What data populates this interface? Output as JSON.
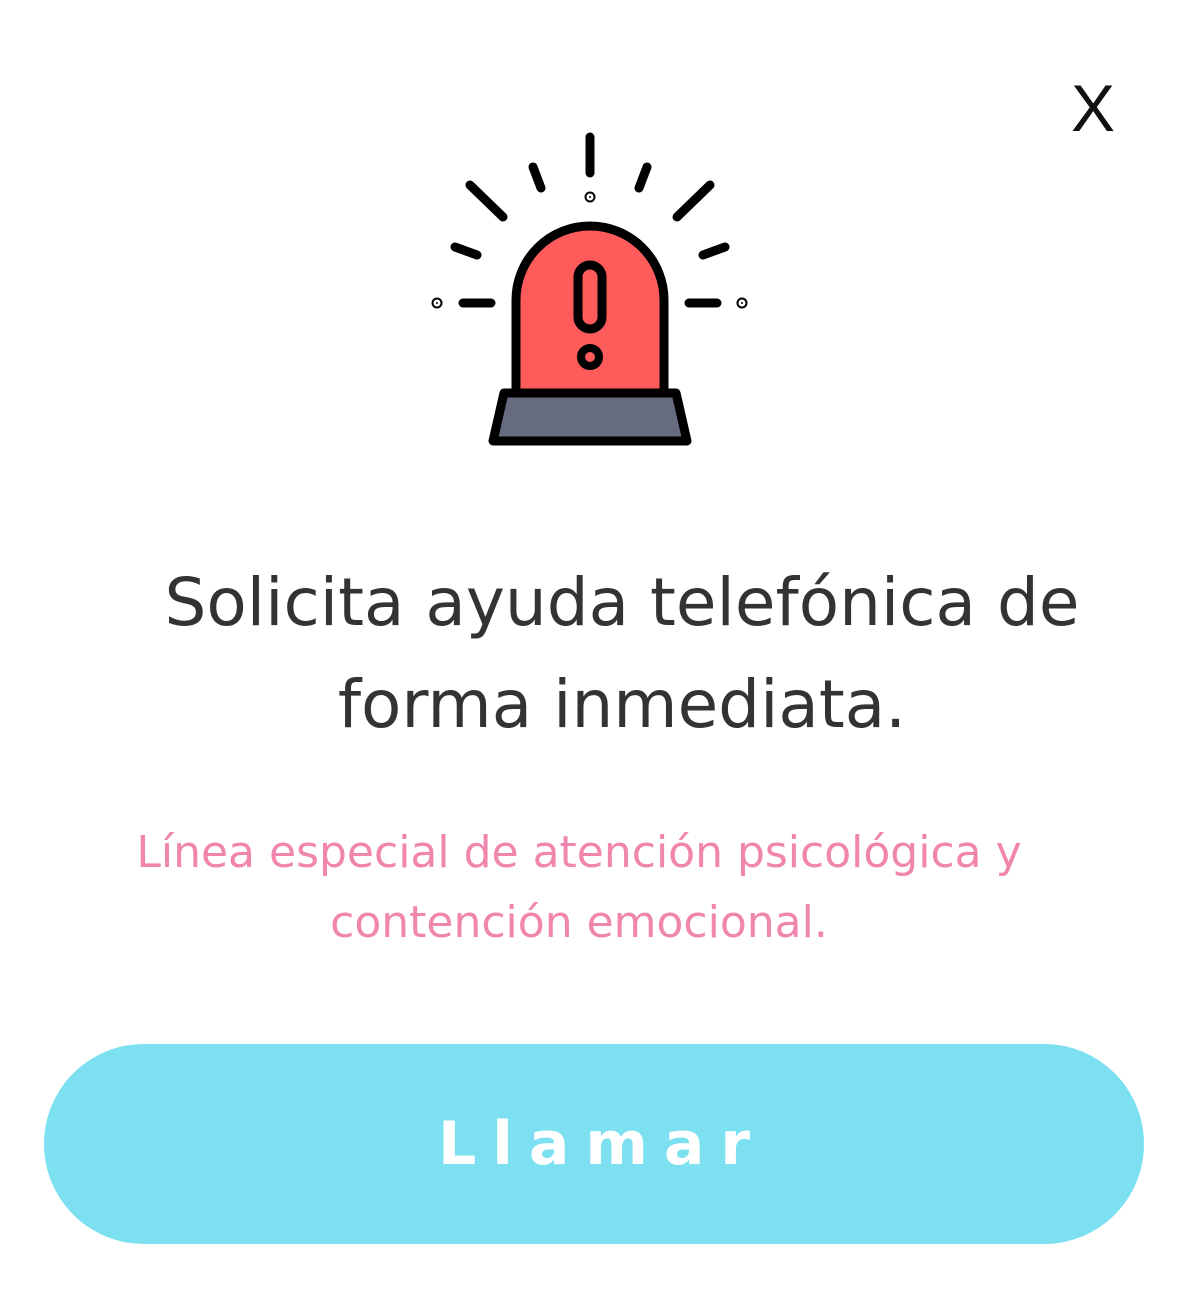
{
  "dialog": {
    "close_label": "X",
    "icon": "alarm-siren-icon",
    "headline": "Solicita ayuda telefónica de forma inmediata.",
    "subtext": "Línea especial de atención psicológica y contención emocional.",
    "call_button_label": "Llamar"
  },
  "colors": {
    "headline": "#333333",
    "subtext": "#f085ae",
    "button_bg": "#7de0f0",
    "button_text": "#ffffff",
    "siren_red": "#ff5b5b",
    "siren_base": "#666b80"
  }
}
